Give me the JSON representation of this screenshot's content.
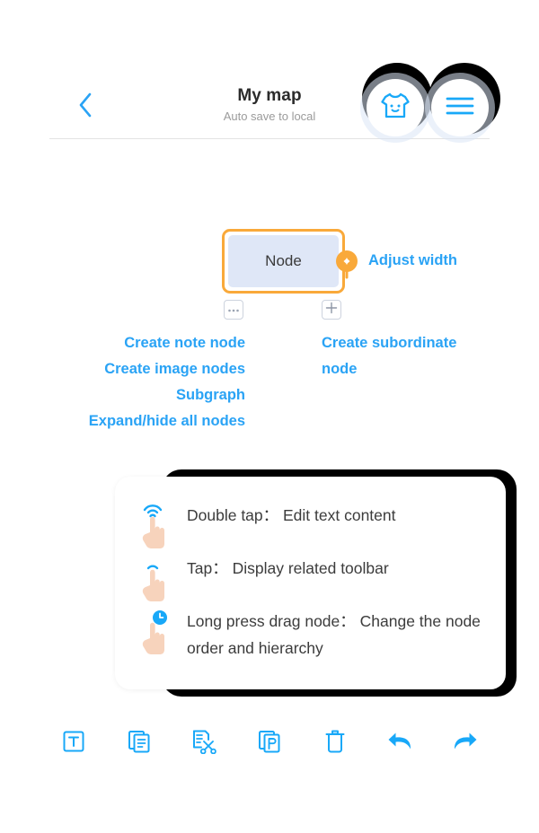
{
  "header": {
    "back_icon": "chevron-left-icon",
    "title": "My map",
    "subtitle": "Auto save to local",
    "shirt_button_icon": "shirt-smiley-icon",
    "menu_button_icon": "hamburger-menu-icon"
  },
  "canvas": {
    "node": {
      "label": "Node",
      "border_color": "#f9a93a",
      "fill_color": "#dfe7f7"
    },
    "handle": {
      "icon": "adjust-width-handle-icon",
      "label": "Adjust width",
      "color": "#f9a93a"
    },
    "more_button_icon": "ellipsis-icon",
    "add_button_icon": "plus-icon",
    "annotation_color": "#2aa3f5",
    "left_annotations": [
      "Create note node",
      "Create image nodes",
      "Subgraph",
      "Expand/hide all nodes"
    ],
    "right_annotation": "Create subordinate node"
  },
  "gesture_card": {
    "rows": [
      {
        "icon": "double-tap-hand-icon",
        "text": "Double tap： Edit text content"
      },
      {
        "icon": "tap-hand-icon",
        "text": "Tap： Display related toolbar"
      },
      {
        "icon": "long-press-hand-icon",
        "text": "Long press drag node： Change the node order and hierarchy"
      }
    ]
  },
  "toolbar": {
    "color": "#18a8f8",
    "items": [
      {
        "icon": "text-box-icon",
        "name": "insert-text"
      },
      {
        "icon": "copy-document-icon",
        "name": "copy"
      },
      {
        "icon": "cut-scissors-icon",
        "name": "cut"
      },
      {
        "icon": "paste-icon",
        "name": "paste"
      },
      {
        "icon": "trash-icon",
        "name": "delete"
      },
      {
        "icon": "undo-arrow-icon",
        "name": "undo"
      },
      {
        "icon": "redo-arrow-icon",
        "name": "redo"
      }
    ]
  }
}
